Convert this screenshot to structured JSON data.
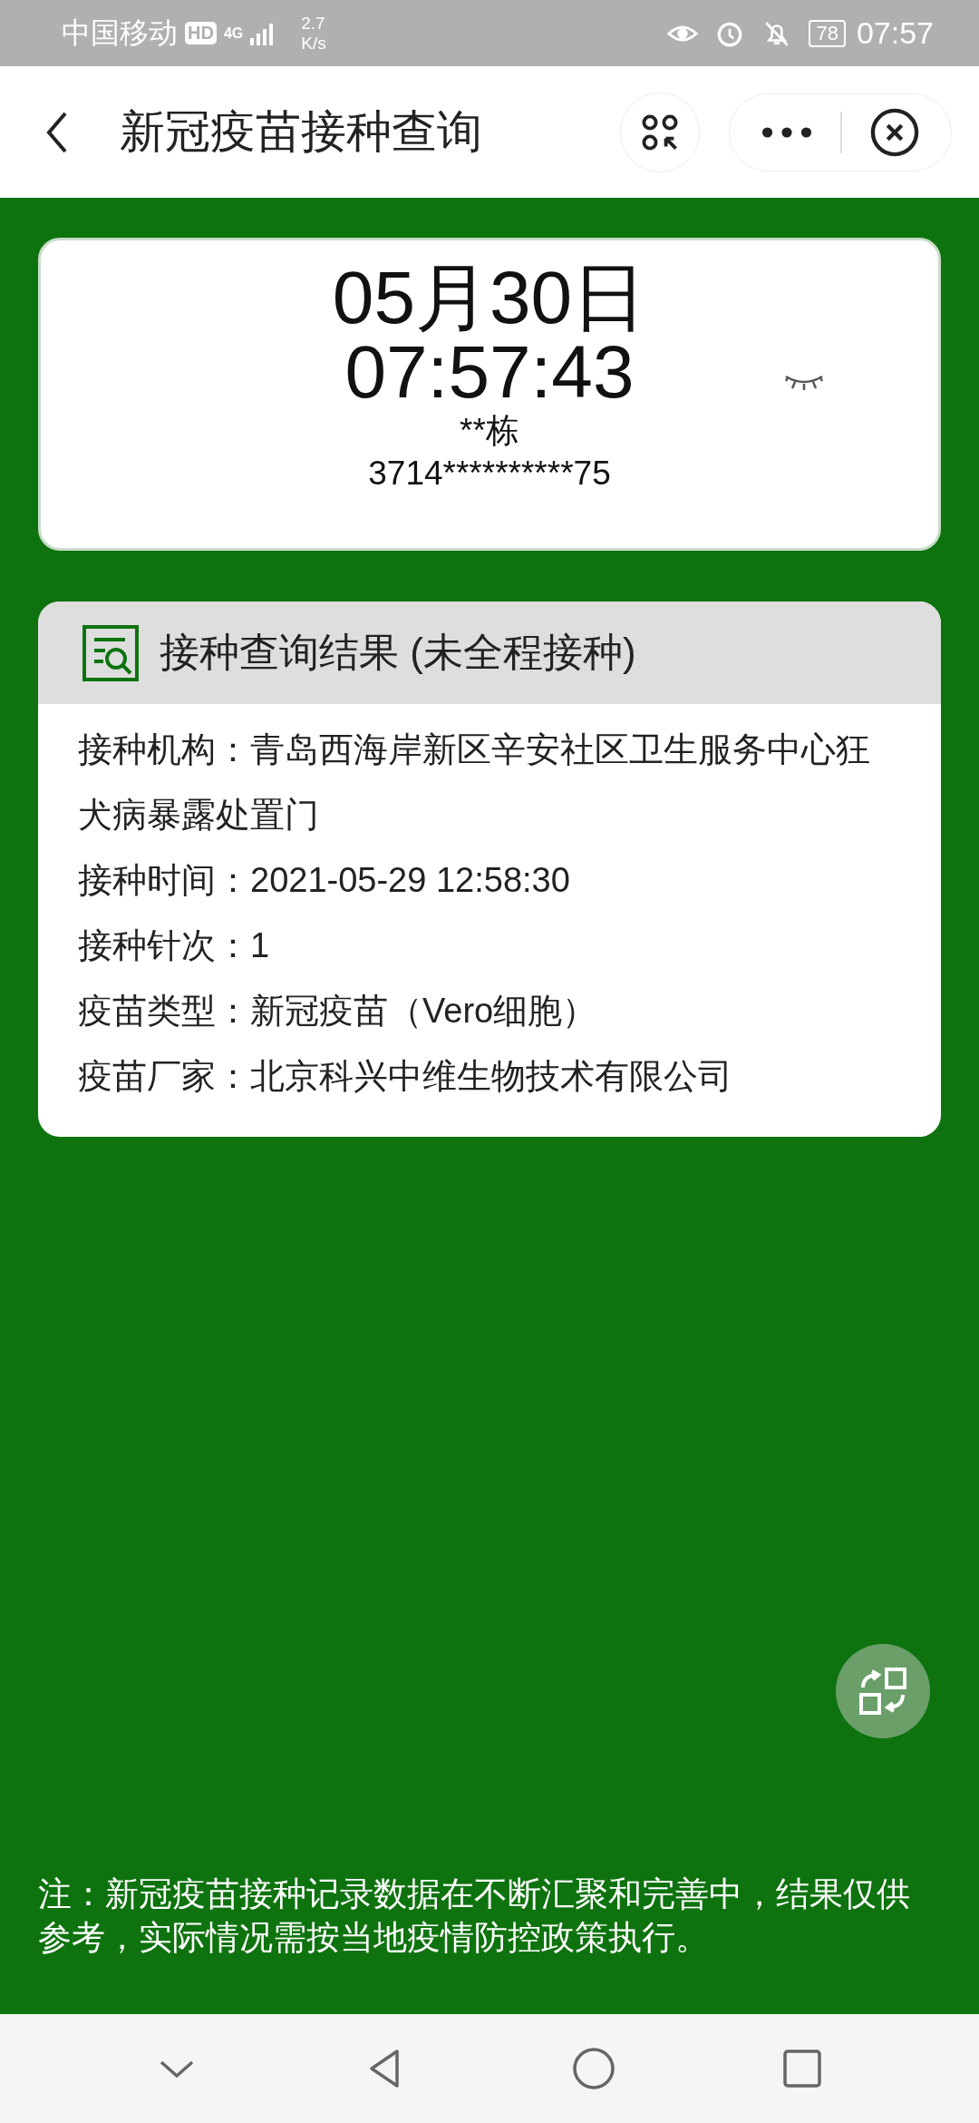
{
  "status_bar": {
    "carrier": "中国移动",
    "hd": "HD",
    "network": "4G",
    "speed_value": "2.7",
    "speed_unit": "K/s",
    "battery": "78",
    "time": "07:57"
  },
  "header": {
    "title": "新冠疫苗接种查询"
  },
  "identity_card": {
    "date": "05月30日",
    "time": "07:57:43",
    "name": "**栋",
    "id_number": "3714**********75"
  },
  "result_card": {
    "title": "接种查询结果 (未全程接种)",
    "rows": [
      {
        "label": "接种机构：",
        "value": "青岛西海岸新区辛安社区卫生服务中心狂犬病暴露处置门"
      },
      {
        "label": "接种时间：",
        "value": "2021-05-29 12:58:30"
      },
      {
        "label": "接种针次：",
        "value": "1"
      },
      {
        "label": "疫苗类型：",
        "value": "新冠疫苗（Vero细胞）"
      },
      {
        "label": "疫苗厂家：",
        "value": "北京科兴中维生物技术有限公司"
      }
    ]
  },
  "note": "注：新冠疫苗接种记录数据在不断汇聚和完善中，结果仅供参考，实际情况需按当地疫情防控政策执行。"
}
